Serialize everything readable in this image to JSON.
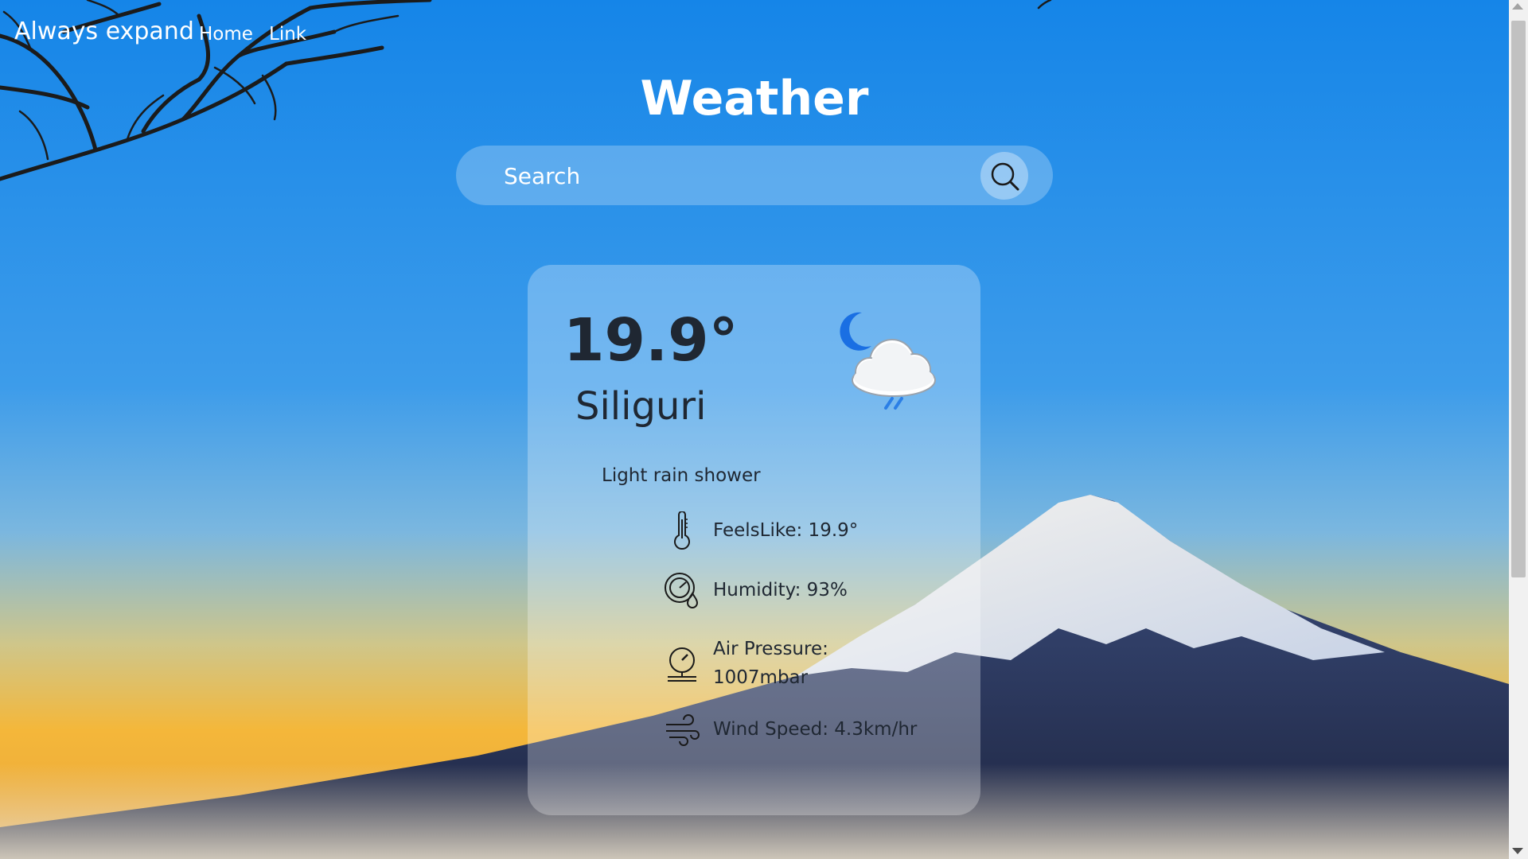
{
  "navbar": {
    "brand": "Always expand",
    "links": [
      "Home",
      "Link"
    ]
  },
  "page": {
    "title": "Weather"
  },
  "search": {
    "placeholder": "Search",
    "icon": "search-icon"
  },
  "weather": {
    "temperature": "19.9°",
    "city": "Siliguri",
    "condition": "Light rain shower",
    "condition_icon": "moon-cloud-rain-icon",
    "details": [
      {
        "icon": "thermometer-icon",
        "text": "FeelsLike: 19.9°"
      },
      {
        "icon": "humidity-icon",
        "text": "Humidity: 93%"
      },
      {
        "icon": "gauge-icon",
        "text": "Air Pressure: 1007mbar"
      },
      {
        "icon": "wind-icon",
        "text": "Wind Speed: 4.3km/hr"
      }
    ]
  },
  "colors": {
    "sky_top": "#1585e8",
    "sky_mid": "#49a6ec",
    "horizon": "#f4b73a",
    "mountain": "#2a3352",
    "snow": "#eef2f6",
    "text_dark": "#1f2732",
    "moon": "#1a6fe3"
  }
}
